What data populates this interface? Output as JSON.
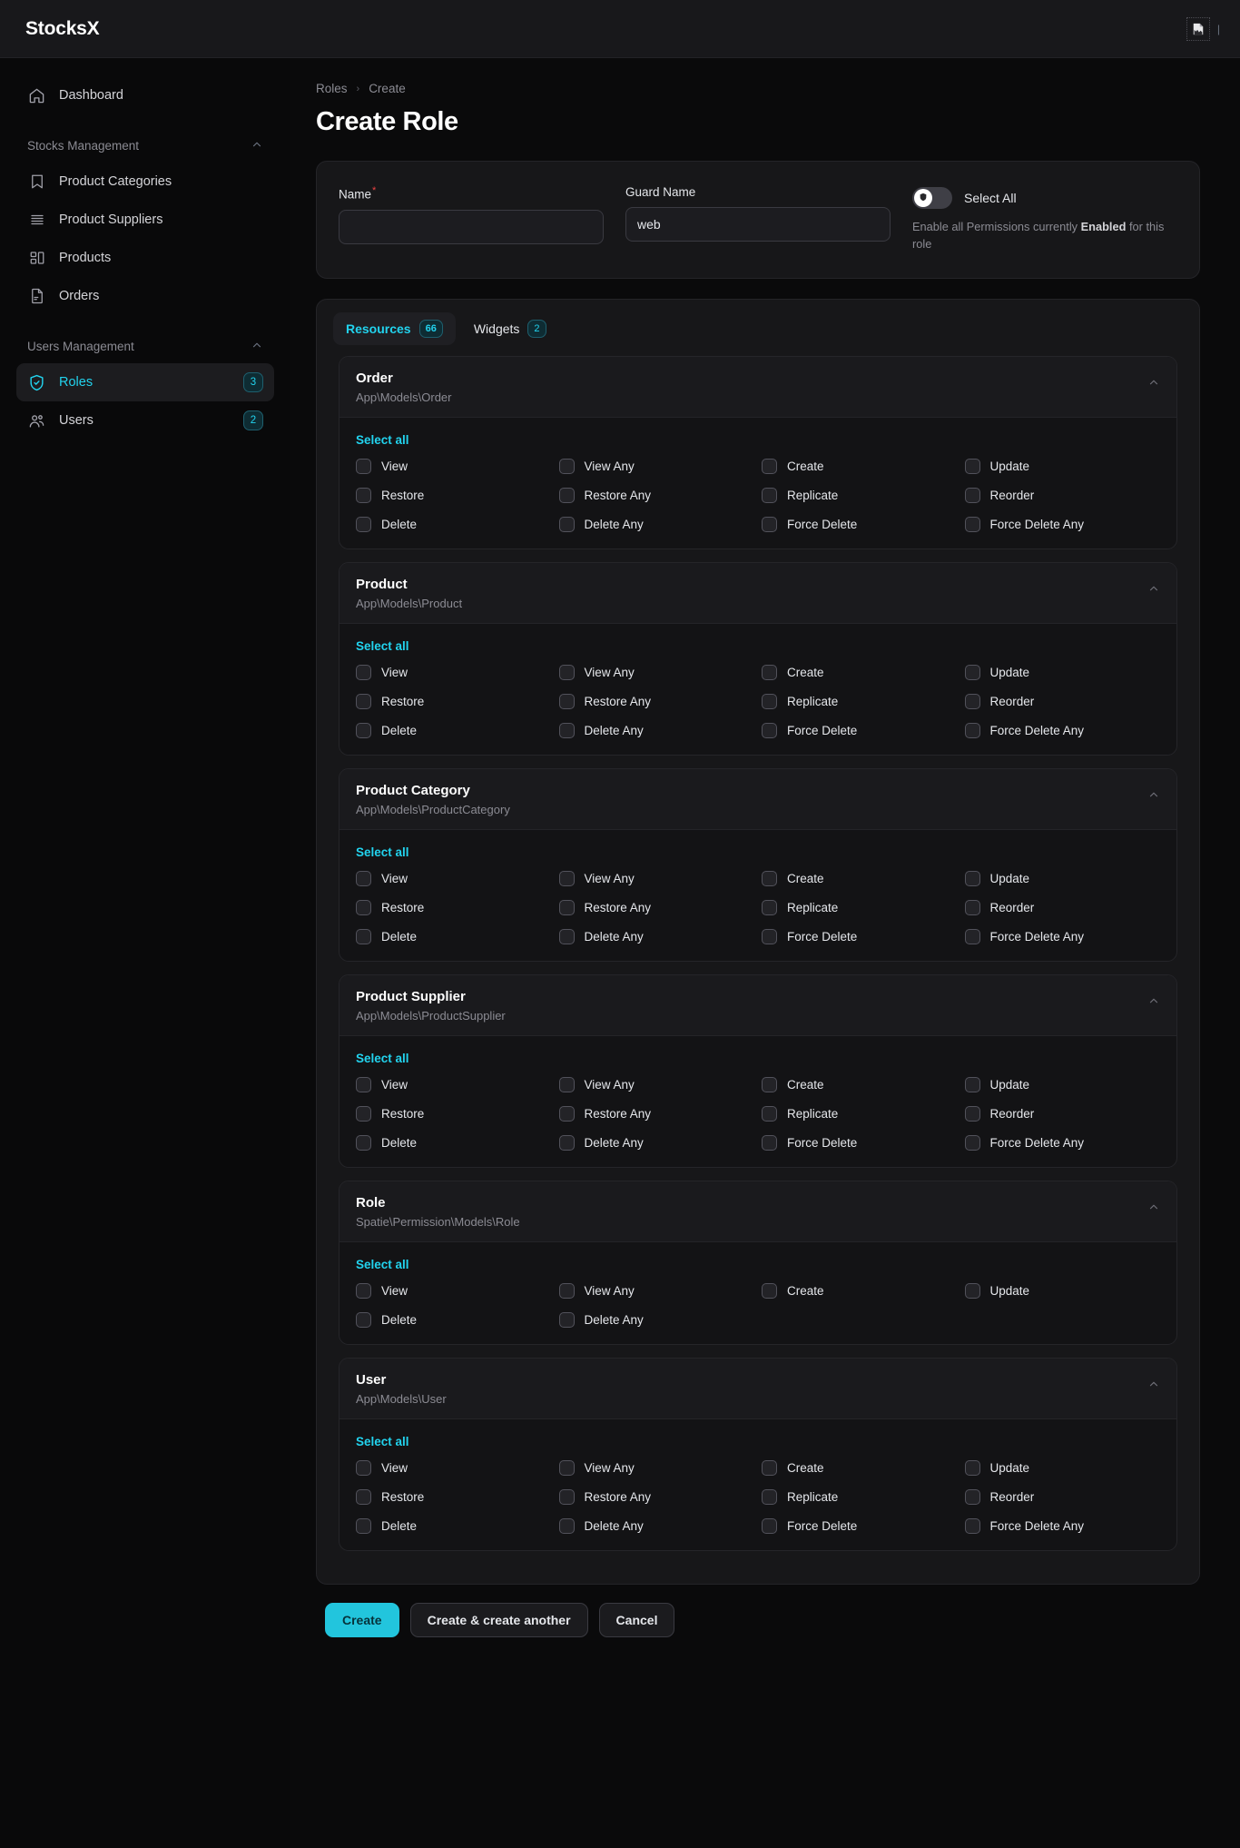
{
  "topbar": {
    "brand": "StocksX",
    "avatar_icon": "broken-image-icon",
    "caret": "|"
  },
  "sidebar": {
    "dashboard": {
      "label": "Dashboard",
      "icon": "home-icon"
    },
    "groups": [
      {
        "label": "Stocks Management",
        "chevron": "⌃",
        "items": [
          {
            "label": "Product Categories",
            "icon": "bookmark-icon",
            "badge": ""
          },
          {
            "label": "Product Suppliers",
            "icon": "layers-icon",
            "badge": ""
          },
          {
            "label": "Products",
            "icon": "blocks-icon",
            "badge": ""
          },
          {
            "label": "Orders",
            "icon": "document-icon",
            "badge": ""
          }
        ]
      },
      {
        "label": "Users Management",
        "chevron": "⌃",
        "items": [
          {
            "label": "Roles",
            "icon": "shield-check-icon",
            "badge": "3",
            "active": true
          },
          {
            "label": "Users",
            "icon": "users-icon",
            "badge": "2",
            "active": false
          }
        ]
      }
    ]
  },
  "breadcrumb": {
    "parent": "Roles",
    "separator": "›",
    "current": "Create"
  },
  "page_title": "Create Role",
  "form": {
    "name": {
      "label": "Name",
      "required_marker": "*",
      "value": "",
      "placeholder": ""
    },
    "guard_name": {
      "label": "Guard Name",
      "value": "web",
      "placeholder": ""
    },
    "select_all": {
      "label": "Select All",
      "state": "off",
      "knob_icon": "shield-icon",
      "help_prefix": "Enable all Permissions currently ",
      "help_bold": "Enabled",
      "help_suffix": " for this role"
    }
  },
  "tabs": [
    {
      "label": "Resources",
      "badge": "66",
      "active": true
    },
    {
      "label": "Widgets",
      "badge": "2",
      "active": false
    }
  ],
  "select_all_label": "Select all",
  "collapse_icon": "chevron-up-icon",
  "sections": [
    {
      "name": "Order",
      "model": "App\\Models\\Order",
      "permissions": [
        "View",
        "View Any",
        "Create",
        "Update",
        "Restore",
        "Restore Any",
        "Replicate",
        "Reorder",
        "Delete",
        "Delete Any",
        "Force Delete",
        "Force Delete Any"
      ]
    },
    {
      "name": "Product",
      "model": "App\\Models\\Product",
      "permissions": [
        "View",
        "View Any",
        "Create",
        "Update",
        "Restore",
        "Restore Any",
        "Replicate",
        "Reorder",
        "Delete",
        "Delete Any",
        "Force Delete",
        "Force Delete Any"
      ]
    },
    {
      "name": "Product Category",
      "model": "App\\Models\\ProductCategory",
      "permissions": [
        "View",
        "View Any",
        "Create",
        "Update",
        "Restore",
        "Restore Any",
        "Replicate",
        "Reorder",
        "Delete",
        "Delete Any",
        "Force Delete",
        "Force Delete Any"
      ]
    },
    {
      "name": "Product Supplier",
      "model": "App\\Models\\ProductSupplier",
      "permissions": [
        "View",
        "View Any",
        "Create",
        "Update",
        "Restore",
        "Restore Any",
        "Replicate",
        "Reorder",
        "Delete",
        "Delete Any",
        "Force Delete",
        "Force Delete Any"
      ]
    },
    {
      "name": "Role",
      "model": "Spatie\\Permission\\Models\\Role",
      "permissions": [
        "View",
        "View Any",
        "Create",
        "Update",
        "Delete",
        "Delete Any"
      ]
    },
    {
      "name": "User",
      "model": "App\\Models\\User",
      "permissions": [
        "View",
        "View Any",
        "Create",
        "Update",
        "Restore",
        "Restore Any",
        "Replicate",
        "Reorder",
        "Delete",
        "Delete Any",
        "Force Delete",
        "Force Delete Any"
      ]
    }
  ],
  "footer": {
    "create": "Create",
    "create_another": "Create & create another",
    "cancel": "Cancel"
  },
  "colors": {
    "accent": "#22d3ee",
    "primary_button": "#22c5dd",
    "required": "#ef4444",
    "page_bg": "#0a0a0b",
    "card_bg": "#171719"
  }
}
